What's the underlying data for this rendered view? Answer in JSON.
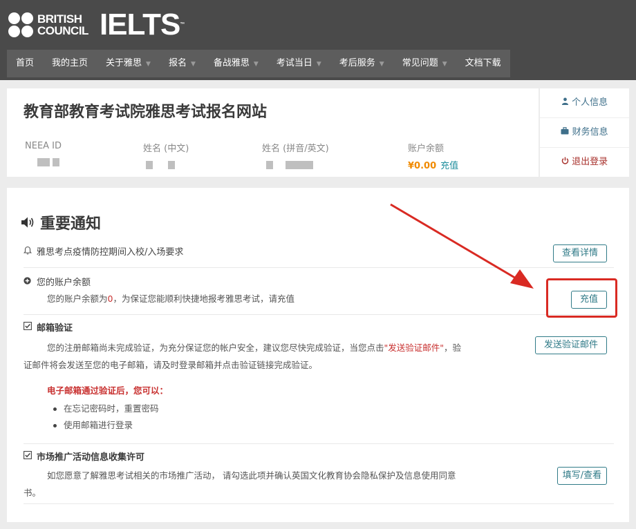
{
  "brand": {
    "british_council": [
      "BRITISH",
      "COUNCIL"
    ],
    "ielts": "IELTS",
    "trademark": "™"
  },
  "nav": [
    {
      "label": "首页",
      "dropdown": false
    },
    {
      "label": "我的主页",
      "dropdown": false
    },
    {
      "label": "关于雅思",
      "dropdown": true
    },
    {
      "label": "报名",
      "dropdown": true
    },
    {
      "label": "备战雅思",
      "dropdown": true
    },
    {
      "label": "考试当日",
      "dropdown": true
    },
    {
      "label": "考后服务",
      "dropdown": true
    },
    {
      "label": "常见问题",
      "dropdown": true
    },
    {
      "label": "文档下载",
      "dropdown": false
    }
  ],
  "profile": {
    "site_title": "教育部教育考试院雅思考试报名网站",
    "neea_label": "NEEA ID",
    "name_cn_label": "姓名 (中文)",
    "name_en_label": "姓名 (拼音/英文)",
    "balance_label": "账户余额",
    "balance_value": "¥0.00",
    "recharge_link": "充值"
  },
  "side_menu": {
    "personal": {
      "icon": "user-icon",
      "label": "个人信息"
    },
    "finance": {
      "icon": "briefcase-icon",
      "label": "财务信息"
    },
    "logout": {
      "icon": "power-icon",
      "label": "退出登录",
      "color": "#a8322d"
    }
  },
  "notice": {
    "title": "重要通知",
    "items": {
      "epidemic": {
        "title": "雅思考点疫情防控期间入校/入场要求",
        "button": "查看详情"
      },
      "balance": {
        "title": "您的账户余额",
        "text_before": "您的账户余额为",
        "amount": "0",
        "text_after": "，为保证您能顺利快捷地报考雅思考试，请充值",
        "button": "充值"
      },
      "email": {
        "title": "邮箱验证",
        "text_1": "您的注册邮箱尚未完成验证，为充分保证您的帐户安全，建议您尽快完成验证，当您点击",
        "text_link": "\"发送验证邮件\"",
        "text_2": "，验",
        "text_3": "证邮件将会发送至您的电子邮箱，请及时登录邮箱并点击验证链接完成验证。",
        "after_title": "电子邮箱通过验证后，您可以：",
        "bullets": [
          "在忘记密码时，重置密码",
          "使用邮箱进行登录"
        ],
        "button": "发送验证邮件"
      },
      "marketing": {
        "title": "市场推广活动信息收集许可",
        "text_1": "如您愿意了解雅思考试相关的市场推广活动， 请勾选此项并确认英国文化教育协会隐私保护及信息使用同意",
        "text_2": "书。",
        "button": "填写/查看"
      }
    }
  },
  "annotation_color": "#d92a23",
  "accent": "#2f7a87"
}
